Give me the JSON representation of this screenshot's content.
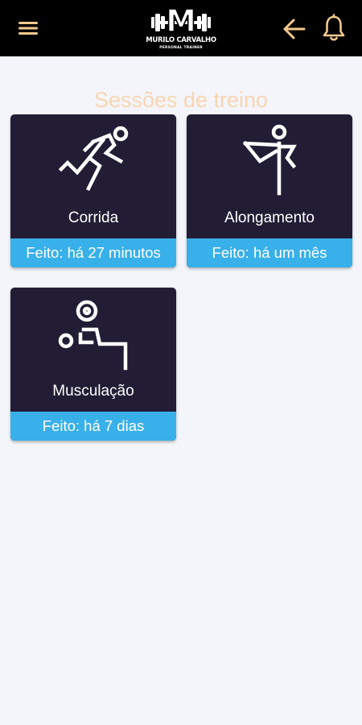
{
  "header": {
    "brand_name": "MURILO CARVALHO",
    "brand_subtitle": "PERSONAL TRAINER",
    "logo_letter": "M",
    "colors": {
      "bar": "#000000",
      "icons": "#f4c98c"
    },
    "icons": {
      "menu": "menu-icon",
      "back": "arrow-left-icon",
      "notifications": "bell-icon"
    }
  },
  "page": {
    "title": "Sessões de treino",
    "title_color": "#f9d5b1",
    "background": "#f3f5fa"
  },
  "sessions": [
    {
      "title": "Corrida",
      "status": "Feito: há 27 minutos",
      "icon": "running-icon"
    },
    {
      "title": "Alongamento",
      "status": "Feito: há um mês",
      "icon": "stretching-icon"
    },
    {
      "title": "Musculação",
      "status": "Feito: há 7 dias",
      "icon": "weightlifting-icon"
    }
  ],
  "card_colors": {
    "body": "#221d35",
    "status_bar": "#38b0e9",
    "text": "#ffffff"
  }
}
